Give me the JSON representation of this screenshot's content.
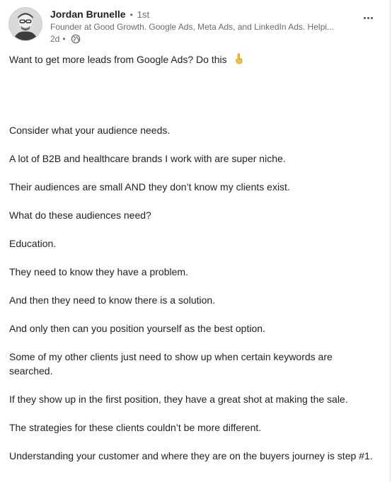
{
  "post": {
    "author": {
      "name": "Jordan Brunelle",
      "separator": "•",
      "degree": "1st",
      "headline": "Founder at Good Growth. Google Ads, Meta Ads, and LinkedIn Ads. Helpi...",
      "time": "2d",
      "time_separator": "•",
      "visibility_icon": "globe-icon"
    },
    "menu_icon": "more-icon",
    "hook_text": "Want to get more leads from Google Ads? Do this",
    "hook_emoji": "pointing-down-icon",
    "paragraphs": [
      "Consider what your audience needs.",
      "A lot of B2B and healthcare brands I work with are super niche.",
      "Their audiences are small AND they don’t know my clients exist.",
      "What do these audiences need?",
      "Education.",
      "They need to know they have a problem.",
      "And then they need to know there is a solution.",
      "And only then can you position yourself as the best option.",
      "Some of my other clients just need to show up when certain keywords are searched.",
      "If they show up in the first position, they have a great shot at making the sale.",
      "The strategies for these clients couldn’t be more different.",
      "Understanding your customer and where they are on the buyers journey is step #1."
    ]
  }
}
